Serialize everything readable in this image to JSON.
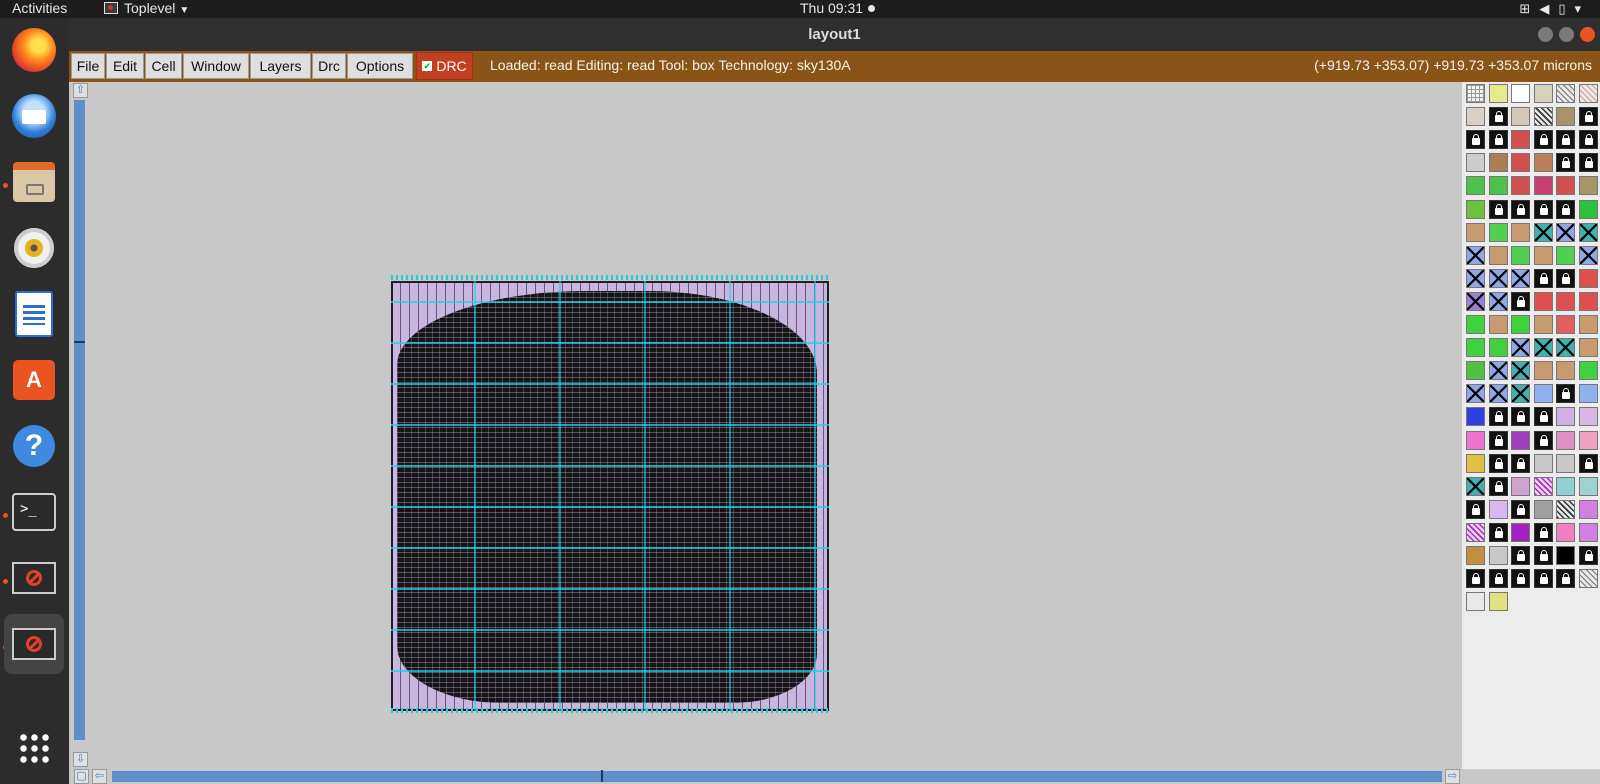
{
  "topbar": {
    "activities": "Activities",
    "app_menu": "Toplevel",
    "clock": "Thu 09:31"
  },
  "dock": {
    "items": [
      {
        "name": "firefox"
      },
      {
        "name": "thunderbird"
      },
      {
        "name": "files"
      },
      {
        "name": "rhythmbox"
      },
      {
        "name": "libreoffice-writer"
      },
      {
        "name": "software-center"
      },
      {
        "name": "help"
      },
      {
        "name": "terminal"
      },
      {
        "name": "app-window"
      },
      {
        "name": "app-window"
      }
    ]
  },
  "window": {
    "title": "layout1"
  },
  "menubar": {
    "menus": [
      "File",
      "Edit",
      "Cell",
      "Window",
      "Layers",
      "Drc",
      "Options"
    ],
    "drc_label": "DRC",
    "status": "Loaded: read Editing: read Tool: box  Technology: sky130A",
    "coords": "(+919.73 +353.07) +919.73 +353.07 microns"
  },
  "colors": {
    "menubar_bg": "#8b5417",
    "drc_button": "#c1401f",
    "canvas_bg": "#c8c8c8",
    "scrollbar": "#5e8fc9",
    "layout_fill": "#c9b5e0",
    "route_cyan": "#2ec9d9"
  },
  "palette": {
    "columns": 6,
    "swatches": [
      [
        "grid",
        "#e8e88c",
        "#ffffff",
        "#d6d0bc",
        "diag-gray",
        "diag-pink"
      ],
      [
        "#d8d0c4",
        "lock",
        "#d4c6b8",
        "diag-dark",
        "#a8946a",
        "lock"
      ],
      [
        "lock",
        "lock",
        "#d05050",
        "lock",
        "lock",
        "lock"
      ],
      [
        "#cccccc",
        "#a87f55",
        "#d05050",
        "#b87e5a",
        "lock",
        "lock"
      ],
      [
        "#4cc24c",
        "#4cc24c",
        "#d05050",
        "#c84070",
        "#d05050",
        "#a8946a"
      ],
      [
        "#70c040",
        "lock",
        "lock",
        "lock",
        "lock",
        "#30c040"
      ],
      [
        "#c89a70",
        "#50d050",
        "#c89a70",
        "x-teal",
        "x-blue",
        "x-teal"
      ],
      [
        "x-blue",
        "#c89a70",
        "#50d050",
        "#c89a70",
        "#50d050",
        "x-blue"
      ],
      [
        "x-blue",
        "x-blue",
        "x-blue",
        "lock",
        "lock",
        "#e05050"
      ],
      [
        "x-purple",
        "x-blue",
        "lock",
        "#e05050",
        "#e05050",
        "#e05050"
      ],
      [
        "#40d040",
        "#c89a70",
        "#40d040",
        "#c89a70",
        "#e06060",
        "#c89a70"
      ],
      [
        "#40d040",
        "#40d040",
        "x-blue",
        "x-teal",
        "x-teal",
        "#c89a70"
      ],
      [
        "#50c040",
        "x-blue",
        "x-teal",
        "#c89a70",
        "#c89a70",
        "#40d040"
      ],
      [
        "x-blue",
        "x-blue",
        "x-teal",
        "#90b0f0",
        "lock",
        "#90b0f0"
      ],
      [
        "#3040e0",
        "lock",
        "lock",
        "lock",
        "#d0b0e0",
        "#d8b8e0"
      ],
      [
        "#f070d0",
        "lock",
        "#a040c0",
        "lock",
        "#e090c0",
        "#f0a0c0"
      ],
      [
        "#e0c040",
        "lock",
        "lock",
        "#c8c8c8",
        "#c8c8c8",
        "lock"
      ],
      [
        "x-teal",
        "lock",
        "#d0a0d0",
        "diag-purple",
        "#90d0d0",
        "#a0d0d0"
      ],
      [
        "lock",
        "#d8b8f0",
        "lock",
        "#a0a0a0",
        "diag-dark",
        "#d080e0"
      ],
      [
        "diag-purple",
        "lock",
        "#a020c0",
        "lock",
        "#f080c0",
        "#d080e0"
      ],
      [
        "#c09040",
        "#c8c8c8",
        "lock",
        "lock",
        "#000000",
        "lock"
      ],
      [
        "lock",
        "lock",
        "lock",
        "lock",
        "lock",
        "diag-gray"
      ],
      [
        "#e8e8e8",
        "#e0e080"
      ]
    ]
  }
}
